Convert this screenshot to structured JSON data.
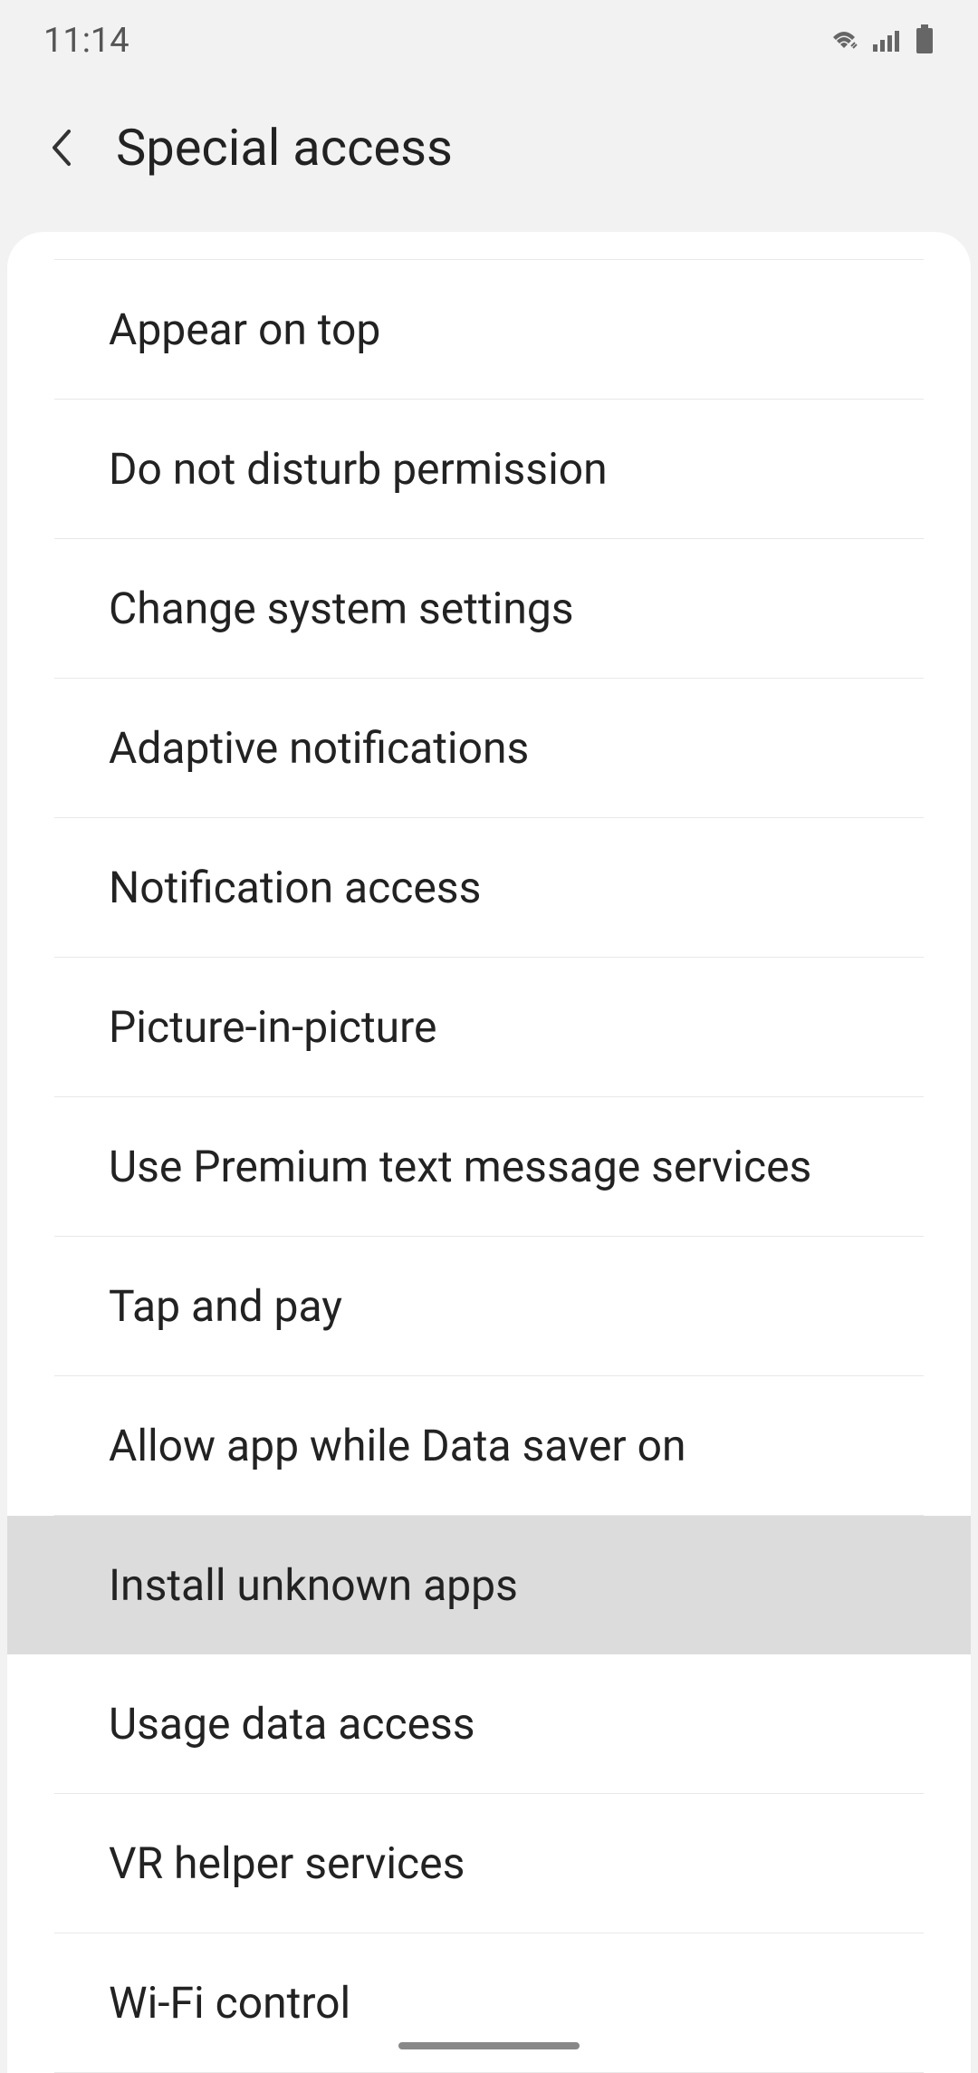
{
  "statusBar": {
    "time": "11:14"
  },
  "header": {
    "title": "Special access"
  },
  "list": {
    "items": [
      {
        "label": "Appear on top",
        "selected": false
      },
      {
        "label": "Do not disturb permission",
        "selected": false
      },
      {
        "label": "Change system settings",
        "selected": false
      },
      {
        "label": "Adaptive notifications",
        "selected": false
      },
      {
        "label": "Notification access",
        "selected": false
      },
      {
        "label": "Picture-in-picture",
        "selected": false
      },
      {
        "label": "Use Premium text message services",
        "selected": false
      },
      {
        "label": "Tap and pay",
        "selected": false
      },
      {
        "label": "Allow app while Data saver on",
        "selected": false
      },
      {
        "label": "Install unknown apps",
        "selected": true
      },
      {
        "label": "Usage data access",
        "selected": false
      },
      {
        "label": "VR helper services",
        "selected": false
      },
      {
        "label": "Wi-Fi control",
        "selected": false
      }
    ]
  }
}
